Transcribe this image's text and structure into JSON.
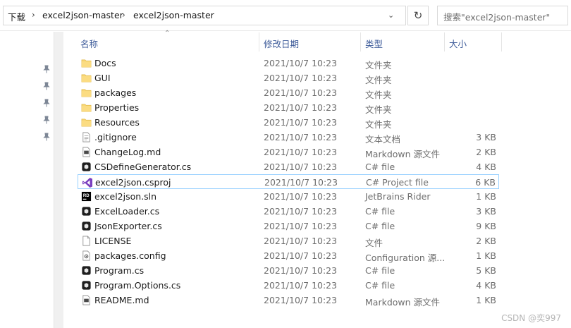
{
  "breadcrumb": {
    "items": [
      "下载",
      "excel2json-master",
      "excel2json-master"
    ],
    "separator": "›"
  },
  "search": {
    "placeholder": "搜索\"excel2json-master\""
  },
  "columns": {
    "name": "名称",
    "modified": "修改日期",
    "type": "类型",
    "size": "大小"
  },
  "files": [
    {
      "name": "Docs",
      "modified": "2021/10/7 10:23",
      "type": "文件夹",
      "size": "",
      "icon": "folder-icon"
    },
    {
      "name": "GUI",
      "modified": "2021/10/7 10:23",
      "type": "文件夹",
      "size": "",
      "icon": "folder-icon"
    },
    {
      "name": "packages",
      "modified": "2021/10/7 10:23",
      "type": "文件夹",
      "size": "",
      "icon": "folder-icon"
    },
    {
      "name": "Properties",
      "modified": "2021/10/7 10:23",
      "type": "文件夹",
      "size": "",
      "icon": "folder-icon"
    },
    {
      "name": "Resources",
      "modified": "2021/10/7 10:23",
      "type": "文件夹",
      "size": "",
      "icon": "folder-icon"
    },
    {
      "name": ".gitignore",
      "modified": "2021/10/7 10:23",
      "type": "文本文档",
      "size": "3 KB",
      "icon": "text-file-icon"
    },
    {
      "name": "ChangeLog.md",
      "modified": "2021/10/7 10:23",
      "type": "Markdown 源文件",
      "size": "2 KB",
      "icon": "markdown-file-icon"
    },
    {
      "name": "CSDefineGenerator.cs",
      "modified": "2021/10/7 10:23",
      "type": "C# file",
      "size": "4 KB",
      "icon": "csharp-file-icon"
    },
    {
      "name": "excel2json.csproj",
      "modified": "2021/10/7 10:23",
      "type": "C# Project file",
      "size": "6 KB",
      "icon": "visual-studio-icon"
    },
    {
      "name": "excel2json.sln",
      "modified": "2021/10/7 10:23",
      "type": "JetBrains Rider",
      "size": "1 KB",
      "icon": "rider-icon"
    },
    {
      "name": "ExcelLoader.cs",
      "modified": "2021/10/7 10:23",
      "type": "C# file",
      "size": "3 KB",
      "icon": "csharp-file-icon"
    },
    {
      "name": "JsonExporter.cs",
      "modified": "2021/10/7 10:23",
      "type": "C# file",
      "size": "9 KB",
      "icon": "csharp-file-icon"
    },
    {
      "name": "LICENSE",
      "modified": "2021/10/7 10:23",
      "type": "文件",
      "size": "2 KB",
      "icon": "blank-file-icon"
    },
    {
      "name": "packages.config",
      "modified": "2021/10/7 10:23",
      "type": "Configuration 源...",
      "size": "1 KB",
      "icon": "config-file-icon"
    },
    {
      "name": "Program.cs",
      "modified": "2021/10/7 10:23",
      "type": "C# file",
      "size": "5 KB",
      "icon": "csharp-file-icon"
    },
    {
      "name": "Program.Options.cs",
      "modified": "2021/10/7 10:23",
      "type": "C# file",
      "size": "4 KB",
      "icon": "csharp-file-icon"
    },
    {
      "name": "README.md",
      "modified": "2021/10/7 10:23",
      "type": "Markdown 源文件",
      "size": "1 KB",
      "icon": "markdown-file-icon"
    }
  ],
  "selected_file": "excel2json.csproj",
  "watermark": "CSDN @奕997",
  "colors": {
    "header_text": "#3c5a99",
    "folder": "#f8d775",
    "selection_border": "#99d1ff",
    "vs_purple": "#7a3fbf"
  }
}
